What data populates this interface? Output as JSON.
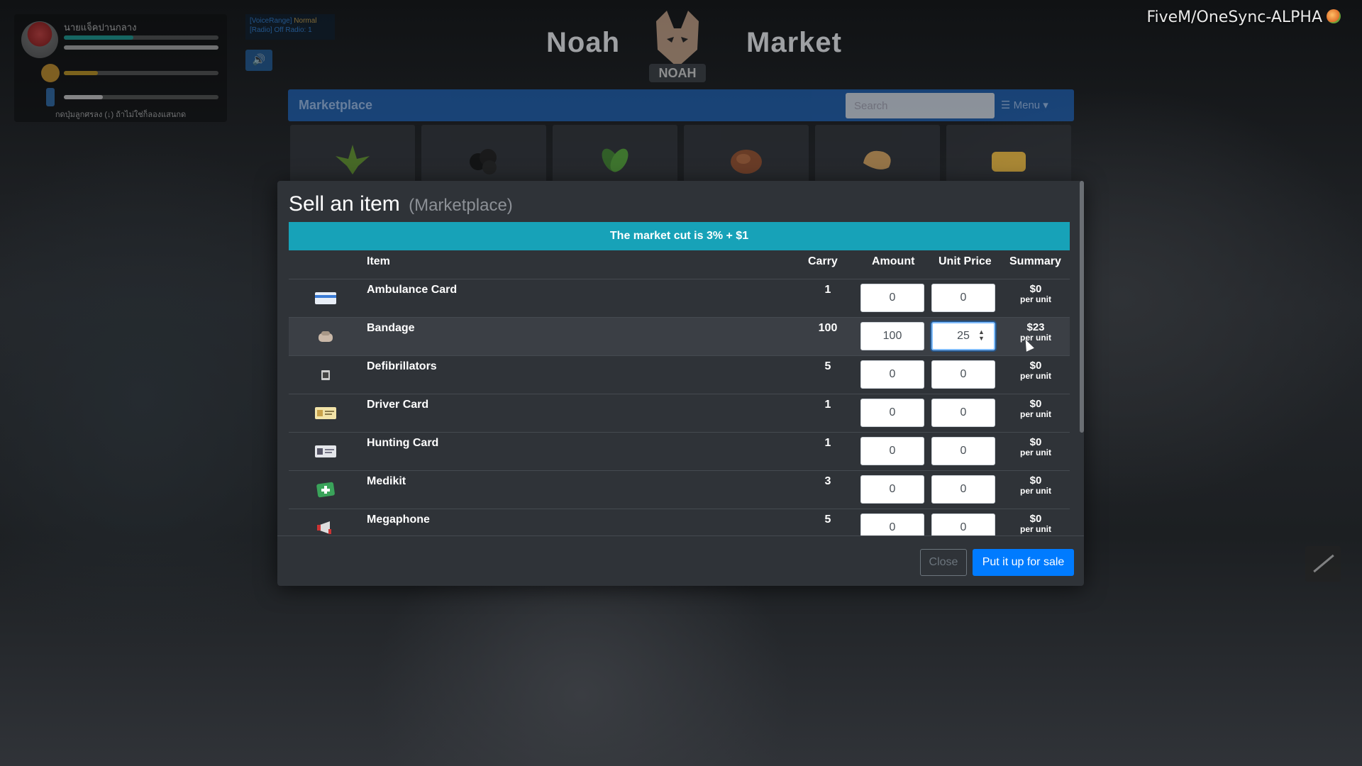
{
  "hud": {
    "player_name": "นายแจ็คปานกลาง",
    "footer_text": "กดปุ่มลูกศรลง (↓) ถ้าไม่ใช่ก็ลองแสนกด",
    "voice_label": "[VoiceRange]",
    "voice_mode": "Normal",
    "radio_label": "[Radio] Off Radio: 1"
  },
  "server_name": "FiveM/OneSync-ALPHA",
  "market": {
    "title_left": "Noah",
    "title_right": "Market",
    "bar_title": "Marketplace",
    "search_placeholder": "Search",
    "menu_label": "☰ Menu ▾"
  },
  "modal": {
    "title": "Sell an item",
    "subtitle": "(Marketplace)",
    "alert": "The market cut is 3% + $1",
    "columns": {
      "item": "Item",
      "carry": "Carry",
      "amount": "Amount",
      "unit_price": "Unit Price",
      "summary": "Summary"
    },
    "per_unit": "per unit",
    "rows": [
      {
        "name": "Ambulance Card",
        "carry": "1",
        "amount": "0",
        "price": "0",
        "summary": "$0",
        "icon": "ambulance-card-icon"
      },
      {
        "name": "Bandage",
        "carry": "100",
        "amount": "100",
        "price": "25",
        "summary": "$23",
        "icon": "bandage-icon"
      },
      {
        "name": "Defibrillators",
        "carry": "5",
        "amount": "0",
        "price": "0",
        "summary": "$0",
        "icon": "defibrillator-icon"
      },
      {
        "name": "Driver Card",
        "carry": "1",
        "amount": "0",
        "price": "0",
        "summary": "$0",
        "icon": "driver-card-icon"
      },
      {
        "name": "Hunting Card",
        "carry": "1",
        "amount": "0",
        "price": "0",
        "summary": "$0",
        "icon": "hunting-card-icon"
      },
      {
        "name": "Medikit",
        "carry": "3",
        "amount": "0",
        "price": "0",
        "summary": "$0",
        "icon": "medikit-icon"
      },
      {
        "name": "Megaphone",
        "carry": "5",
        "amount": "0",
        "price": "0",
        "summary": "$0",
        "icon": "megaphone-icon"
      }
    ],
    "close_label": "Close",
    "sell_label": "Put it up for sale"
  },
  "colors": {
    "modal_bg": "#2f3338",
    "alert": "#17a2b8",
    "primary": "#007bff",
    "marketplace_bar": "#1b5fb3"
  }
}
